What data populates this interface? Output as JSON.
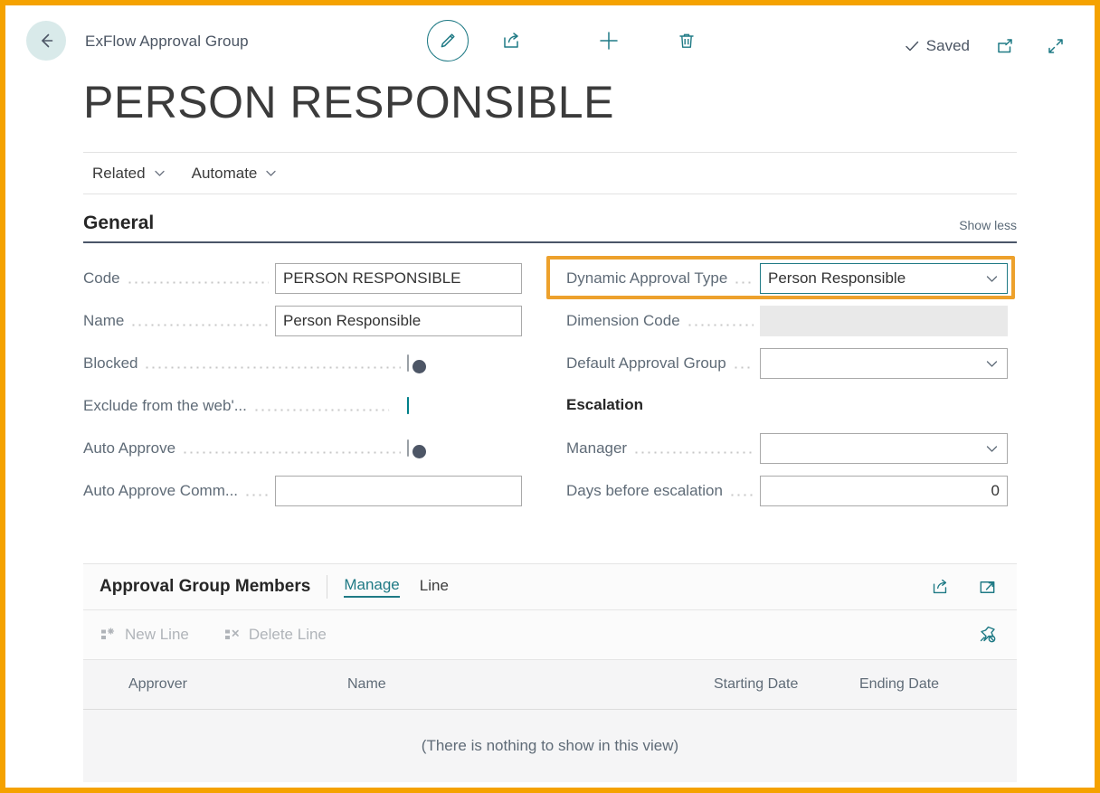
{
  "window": {
    "breadcrumb": "ExFlow Approval Group",
    "page_title": "PERSON RESPONSIBLE",
    "saved_label": "Saved",
    "accent_teal": "#1f7a85",
    "toggle_on_color": "#008089",
    "highlight_orange": "#eda12c",
    "frame_orange": "#f5a200"
  },
  "toolbar": {
    "back_icon": "arrow-left-icon",
    "edit_icon": "pencil-icon",
    "share_icon": "share-icon",
    "new_icon": "plus-icon",
    "delete_icon": "trash-icon",
    "saved_check_icon": "check-icon",
    "open_new_window_icon": "open-in-new-window-icon",
    "expand_icon": "expand-diagonal-icon"
  },
  "menubar": {
    "items": [
      {
        "label": "Related",
        "icon": "chevron-down-icon"
      },
      {
        "label": "Automate",
        "icon": "chevron-down-icon"
      }
    ]
  },
  "general": {
    "title": "General",
    "show_less": "Show less",
    "left_fields": [
      {
        "label": "Code",
        "type": "text",
        "value": "PERSON RESPONSIBLE"
      },
      {
        "label": "Name",
        "type": "text",
        "value": "Person Responsible"
      },
      {
        "label": "Blocked",
        "type": "toggle",
        "value": "off"
      },
      {
        "label": "Exclude from the web'...",
        "type": "toggle",
        "value": "on"
      },
      {
        "label": "Auto Approve",
        "type": "toggle",
        "value": "off"
      },
      {
        "label": "Auto Approve Comm...",
        "type": "text",
        "value": ""
      }
    ],
    "right_fields": [
      {
        "label": "Dynamic Approval Type",
        "type": "combo",
        "value": "Person Responsible",
        "focused": true
      },
      {
        "label": "Dimension Code",
        "type": "text-disabled",
        "value": ""
      },
      {
        "label": "Default Approval Group",
        "type": "combo",
        "value": ""
      }
    ],
    "escalation": {
      "title": "Escalation",
      "fields": [
        {
          "label": "Manager",
          "type": "combo",
          "value": ""
        },
        {
          "label": "Days before escalation",
          "type": "number",
          "value": "0"
        }
      ]
    }
  },
  "lines_part": {
    "title": "Approval Group Members",
    "tabs": [
      {
        "label": "Manage",
        "active": true
      },
      {
        "label": "Line",
        "active": false
      }
    ],
    "head_icons": [
      {
        "icon": "share-icon"
      },
      {
        "icon": "open-in-new-window-icon"
      }
    ],
    "actions": [
      {
        "label": "New Line",
        "icon": "new-line-icon",
        "disabled": true
      },
      {
        "label": "Delete Line",
        "icon": "delete-line-icon",
        "disabled": true
      }
    ],
    "pin_icon": "unpin-icon",
    "columns": [
      "Approver",
      "Name",
      "Starting Date",
      "Ending Date"
    ],
    "rows": [],
    "empty_message": "(There is nothing to show in this view)"
  }
}
